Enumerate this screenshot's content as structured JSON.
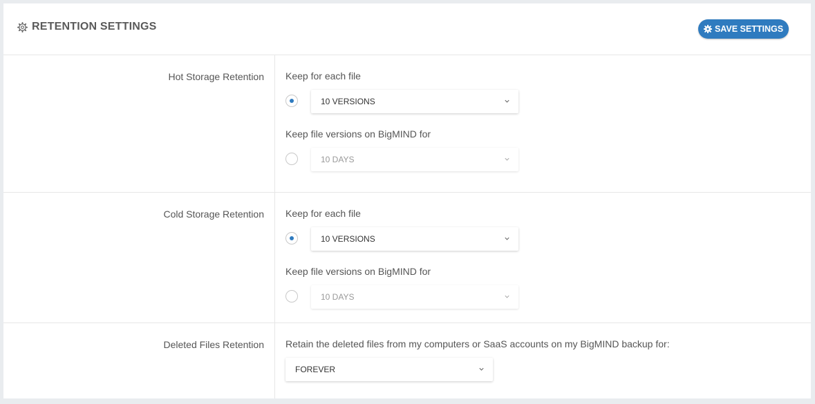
{
  "header": {
    "title": "RETENTION SETTINGS",
    "save_label": "SAVE SETTINGS"
  },
  "sections": [
    {
      "label": "Hot Storage Retention",
      "version_label": "Keep for each file",
      "version_value": "10 VERSIONS",
      "version_selected": true,
      "days_label": "Keep file versions on BigMIND for",
      "days_value": "10 DAYS",
      "days_selected": false
    },
    {
      "label": "Cold Storage Retention",
      "version_label": "Keep for each file",
      "version_value": "10 VERSIONS",
      "version_selected": true,
      "days_label": "Keep file versions on BigMIND for",
      "days_value": "10 DAYS",
      "days_selected": false
    }
  ],
  "deleted": {
    "label": "Deleted Files Retention",
    "description": "Retain the deleted files from my computers or SaaS accounts on my BigMIND backup for:",
    "value": "FOREVER"
  },
  "colors": {
    "accent": "#2f7bbf",
    "background": "#e9ecef",
    "panel": "#ffffff"
  },
  "icons": {
    "header": "gear-icon",
    "save_button": "gear-icon",
    "select": "chevron-down-icon"
  }
}
